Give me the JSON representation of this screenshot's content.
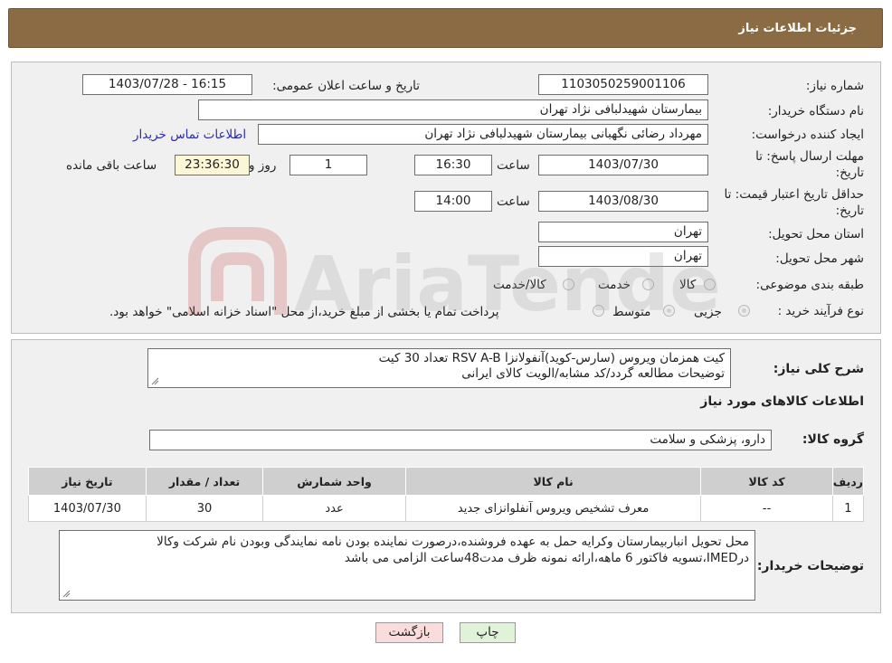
{
  "header": {
    "title": "جزئیات اطلاعات نیاز"
  },
  "fields": {
    "need_number_label": "شماره نیاز:",
    "need_number": "1103050259001106",
    "announce_label": "تاریخ و ساعت اعلان عمومی:",
    "announce_value": "1403/07/28 - 16:15",
    "buyer_org_label": "نام دستگاه خریدار:",
    "buyer_org": "بیمارستان شهیدلبافی نژاد تهران",
    "creator_label": "ایجاد کننده درخواست:",
    "creator": "مهرداد رضائی نگهبانی بیمارستان شهیدلبافی نژاد تهران",
    "contact_link": "اطلاعات تماس خریدار",
    "deadline_label_1": "مهلت ارسال پاسخ: تا",
    "deadline_label_2": "تاریخ:",
    "deadline_date": "1403/07/30",
    "time_word": "ساعت",
    "deadline_time": "16:30",
    "days_value": "1",
    "days_word": "روز و",
    "remaining_time": "23:36:30",
    "remaining_word": "ساعت باقی مانده",
    "validity_label_1": "حداقل تاریخ اعتبار قیمت: تا",
    "validity_label_2": "تاریخ:",
    "validity_date": "1403/08/30",
    "validity_time": "14:00",
    "province_label": "استان محل تحویل:",
    "province": "تهران",
    "city_label": "شهر محل تحویل:",
    "city": "تهران",
    "category_label": "طبقه بندی موضوعی:",
    "category_options": [
      "کالا",
      "خدمت",
      "کالا/خدمت"
    ],
    "process_label": "نوع فرآیند خرید :",
    "process_options": [
      "جزیی",
      "متوسط"
    ],
    "process_note": "پرداخت تمام یا بخشی از مبلغ خرید،از محل \"اسناد خزانه اسلامی\" خواهد بود."
  },
  "details": {
    "summary_label": "شرح کلی نیاز:",
    "summary_line1": "کیت همزمان ویروس (سارس-کوید)آنفولانزا RSV  A-B تعداد 30 کیت",
    "summary_line2": "توضیحات مطالعه گردد/کد مشابه/الویت کالای ایرانی",
    "goods_info_title": "اطلاعات کالاهای مورد نیاز",
    "goods_group_label": "گروه کالا:",
    "goods_group": "دارو، پزشکی و سلامت",
    "table_headers": [
      "ردیف",
      "کد کالا",
      "نام کالا",
      "واحد شمارش",
      "تعداد / مقدار",
      "تاریخ نیاز"
    ],
    "table_rows": [
      [
        "1",
        "--",
        "معرف تشخیص ویروس آنفلوانزای جدید",
        "عدد",
        "30",
        "1403/07/30"
      ]
    ],
    "buyer_notes_label": "توضیحات خریدار:",
    "buyer_notes_line1": "محل تحویل انباربیمارستان وکرایه حمل به عهده فروشنده،درصورت نماینده بودن نامه نمایندگی وبودن نام شرکت وکالا",
    "buyer_notes_line2": "درIMED،تسویه فاکتور 6 ماهه،ارائه نمونه ظرف مدت48ساعت الزامی می باشد"
  },
  "buttons": {
    "print": "چاپ",
    "back": "بازگشت"
  },
  "watermark_text": "AriaTender.neT"
}
